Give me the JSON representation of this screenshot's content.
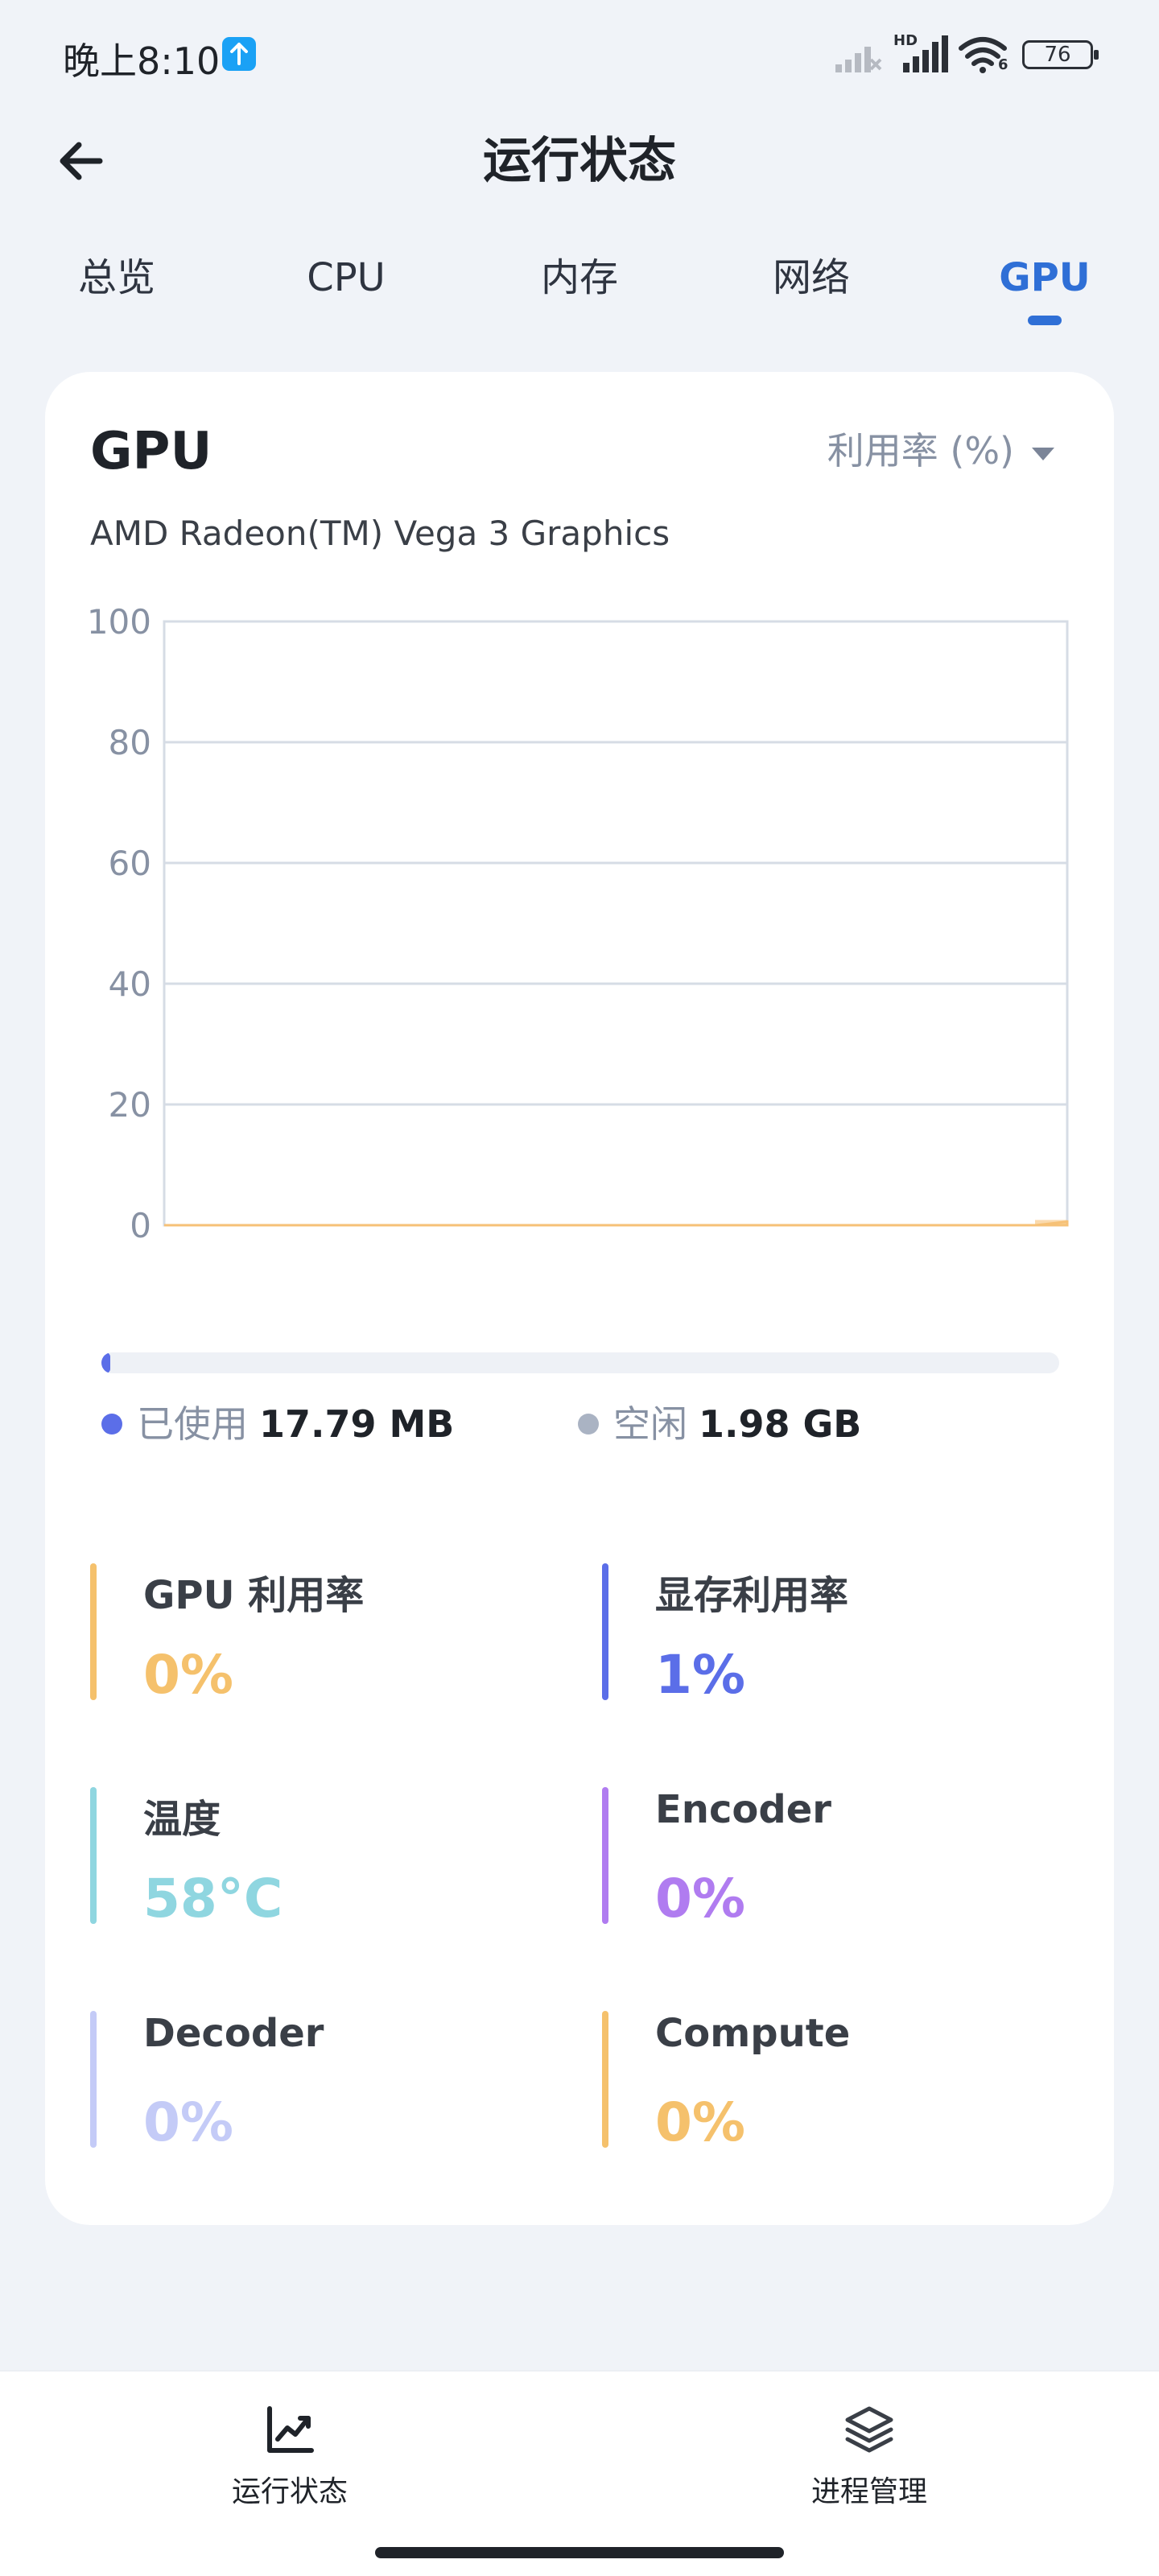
{
  "status_bar": {
    "time": "晚上8:10",
    "battery": "76",
    "hd_label": "HD",
    "wifi_label": "6"
  },
  "header": {
    "title": "运行状态"
  },
  "tabs": [
    {
      "label": "总览",
      "active": false
    },
    {
      "label": "CPU",
      "active": false
    },
    {
      "label": "内存",
      "active": false
    },
    {
      "label": "网络",
      "active": false
    },
    {
      "label": "GPU",
      "active": true
    }
  ],
  "card": {
    "title": "GPU",
    "metric_select": "利用率 (%)",
    "model": "AMD Radeon(TM) Vega 3 Graphics"
  },
  "chart_data": {
    "type": "area",
    "y_ticks": [
      "100",
      "80",
      "60",
      "40",
      "20",
      "0"
    ],
    "ylim": [
      0,
      100
    ],
    "grid": true,
    "values": [
      0,
      0,
      0,
      0,
      0,
      0,
      0,
      0,
      0,
      0,
      0,
      0,
      0,
      0,
      0,
      0,
      0,
      0,
      0,
      0,
      0,
      0,
      0,
      0,
      0,
      0,
      0,
      0,
      0,
      0.6
    ],
    "color": "#f6c177"
  },
  "memory": {
    "used_label": "已使用",
    "used_value": "17.79 MB",
    "free_label": "空闲",
    "free_value": "1.98 GB",
    "used_fraction": 0.009,
    "used_color": "#5b6ee8",
    "free_color": "#aab3c3"
  },
  "stats": [
    {
      "label": "GPU 利用率",
      "value": "0%",
      "color": "#f5c16c"
    },
    {
      "label": "显存利用率",
      "value": "1%",
      "color": "#5b6ee8"
    },
    {
      "label": "温度",
      "value": "58°C",
      "color": "#8fd6e0"
    },
    {
      "label": "Encoder",
      "value": "0%",
      "color": "#b07cf0"
    },
    {
      "label": "Decoder",
      "value": "0%",
      "color": "#c4cbf7"
    },
    {
      "label": "Compute",
      "value": "0%",
      "color": "#f5c16c"
    }
  ],
  "bottom_nav": [
    {
      "label": "运行状态",
      "icon": "chart-line-icon",
      "active": true
    },
    {
      "label": "进程管理",
      "icon": "layers-icon",
      "active": false
    }
  ]
}
